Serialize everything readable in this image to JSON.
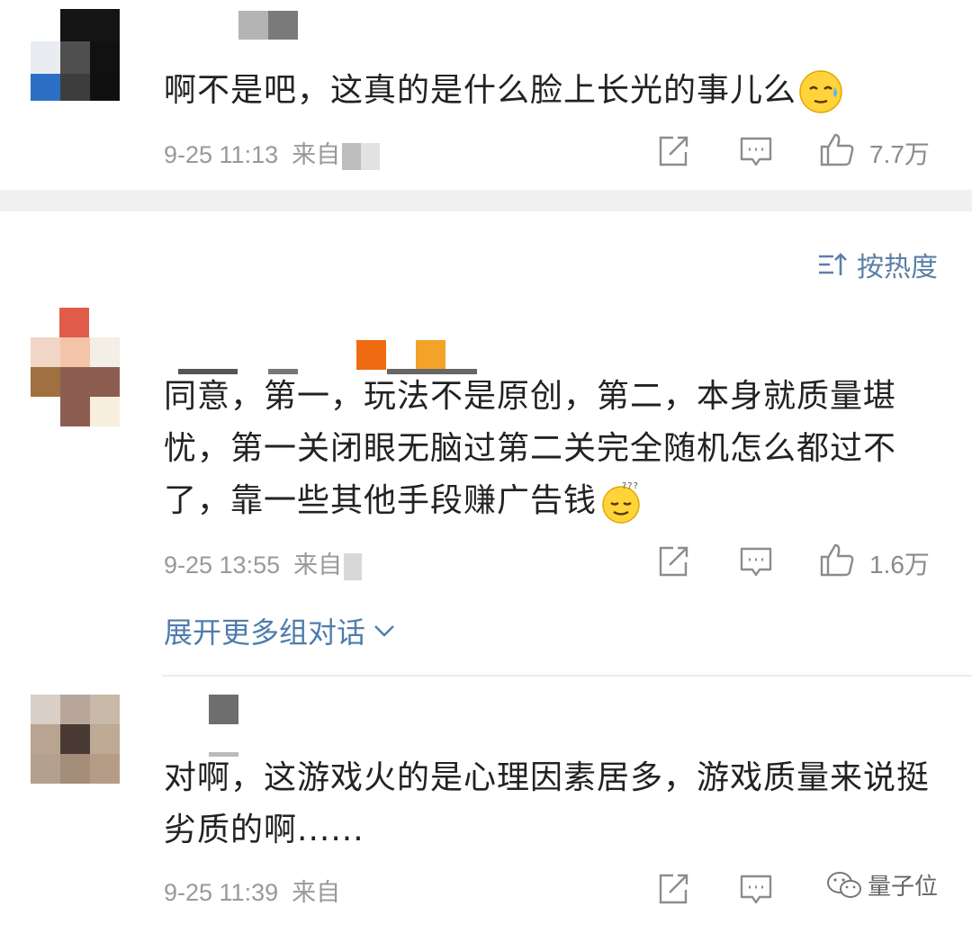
{
  "comments": [
    {
      "text": "啊不是吧，这真的是什么脸上长光的事儿么",
      "emoji": "sweat-emoji",
      "time": "9-25 11:13",
      "source_prefix": "来自",
      "likes": "7.7万"
    },
    {
      "text": "同意，第一，玩法不是原创，第二，本身就质量堪忧，第一关闭眼无脑过第二关完全随机怎么都过不了，靠一些其他手段赚广告钱",
      "emoji": "dizzy-emoji",
      "time": "9-25 13:55",
      "source_prefix": "来自",
      "likes": "1.6万"
    },
    {
      "text": "对啊，这游戏火的是心理因素居多，游戏质量来说挺劣质的啊......",
      "emoji": "",
      "time": "9-25 11:39",
      "source_prefix": "来自",
      "likes": ""
    }
  ],
  "sort_label": "按热度",
  "expand_label": "展开更多组对话",
  "watermark": "量子位",
  "icons": {
    "share": "share-icon",
    "comment": "comment-icon",
    "like": "like-icon",
    "sort": "sort-icon",
    "expand": "chevron-down-icon"
  },
  "colors": {
    "link": "#4f7cad",
    "meta": "#999999",
    "text": "#222222"
  }
}
